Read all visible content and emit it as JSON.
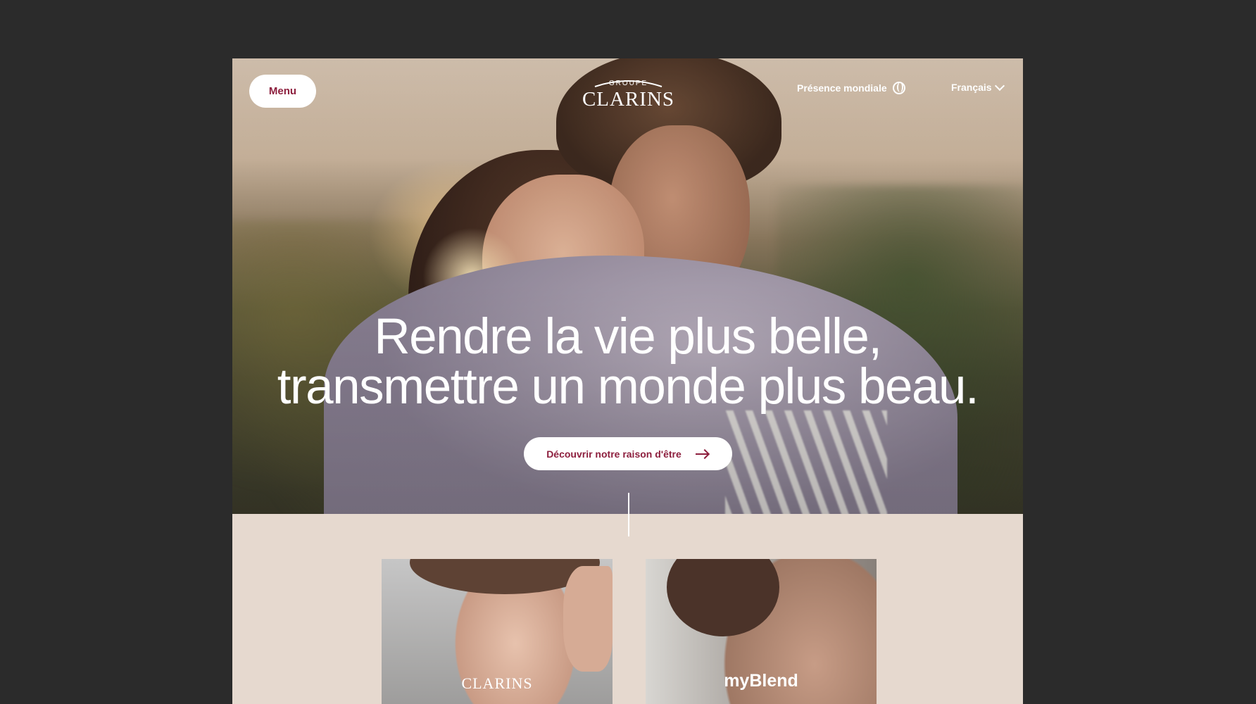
{
  "header": {
    "menu_label": "Menu",
    "logo_top": "GROUPE",
    "logo_main": "CLARINS",
    "presence_label": "Présence mondiale",
    "presence_icon": "globe-icon",
    "language_label": "Français",
    "language_icon": "chevron-down-icon"
  },
  "hero": {
    "headline_line1": "Rendre la vie plus belle,",
    "headline_line2": "transmettre un monde plus beau.",
    "cta_label": "Découvrir notre raison d'être",
    "cta_icon": "arrow-right-icon"
  },
  "cards": [
    {
      "label": "CLARINS"
    },
    {
      "label": "myBlend"
    }
  ],
  "colors": {
    "accent": "#8d1f3e",
    "page_background": "#e6d9cf",
    "outer_background": "#2b2b2b"
  }
}
